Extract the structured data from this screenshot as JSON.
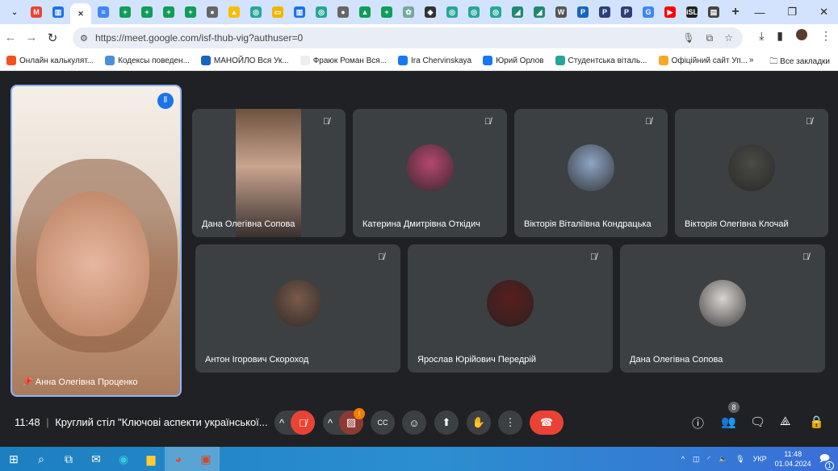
{
  "browser": {
    "tabs": [
      {
        "icon": "gmail-icon",
        "color": "#ea4335",
        "label": "M"
      },
      {
        "icon": "docs-icon",
        "color": "#1a73e8",
        "label": "▥"
      },
      {
        "icon": "close-icon",
        "color": "",
        "label": "✕",
        "active": true
      },
      {
        "icon": "docs-icon",
        "color": "#4285f4",
        "label": "≡"
      },
      {
        "icon": "sheets-icon",
        "color": "#0f9d58",
        "label": "+"
      },
      {
        "icon": "sheets-icon",
        "color": "#0f9d58",
        "label": "+"
      },
      {
        "icon": "sheets-icon",
        "color": "#0f9d58",
        "label": "+"
      },
      {
        "icon": "sheets-icon",
        "color": "#0f9d58",
        "label": "+"
      },
      {
        "icon": "globe-icon",
        "color": "#666",
        "label": "●"
      },
      {
        "icon": "drive-icon",
        "color": "#fbbc04",
        "label": "▲"
      },
      {
        "icon": "site-icon",
        "color": "#26a69a",
        "label": "◎"
      },
      {
        "icon": "slides-icon",
        "color": "#f4b400",
        "label": "▭"
      },
      {
        "icon": "docs-icon",
        "color": "#1a73e8",
        "label": "▥"
      },
      {
        "icon": "site-icon",
        "color": "#26a69a",
        "label": "◎"
      },
      {
        "icon": "globe-icon",
        "color": "#666",
        "label": "●"
      },
      {
        "icon": "drive-icon",
        "color": "#0f9d58",
        "label": "▲"
      },
      {
        "icon": "sheets-icon",
        "color": "#0f9d58",
        "label": "+"
      },
      {
        "icon": "chatgpt-icon",
        "color": "#74aa9c",
        "label": "✿"
      },
      {
        "icon": "site-icon",
        "color": "#333",
        "label": "◆"
      },
      {
        "icon": "site-icon",
        "color": "#26a69a",
        "label": "◎"
      },
      {
        "icon": "site-icon",
        "color": "#26a69a",
        "label": "◎"
      },
      {
        "icon": "site-icon",
        "color": "#26a69a",
        "label": "◎"
      },
      {
        "icon": "site-icon",
        "color": "#1f8a70",
        "label": "◢"
      },
      {
        "icon": "site-icon",
        "color": "#1f8a70",
        "label": "◢"
      },
      {
        "icon": "wikipedia-icon",
        "color": "#555",
        "label": "W"
      },
      {
        "icon": "site-icon",
        "color": "#1565c0",
        "label": "P"
      },
      {
        "icon": "site-icon",
        "color": "#2c3e7a",
        "label": "P"
      },
      {
        "icon": "site-icon",
        "color": "#2c3e7a",
        "label": "P"
      },
      {
        "icon": "translate-icon",
        "color": "#4285f4",
        "label": "G"
      },
      {
        "icon": "youtube-icon",
        "color": "#ff0000",
        "label": "▶"
      },
      {
        "icon": "site-icon",
        "color": "#222",
        "label": "iSL"
      },
      {
        "icon": "site-icon",
        "color": "#444",
        "label": "▤"
      }
    ],
    "new_tab": "+",
    "url": "https://meet.google.com/isf-thub-vig?authuser=0",
    "bookmarks": [
      {
        "label": "Онлайн калькулят...",
        "color": "#f4511e"
      },
      {
        "label": "Кодексы поведен...",
        "color": "#4a90d9"
      },
      {
        "label": "МАНОЙЛО Вся Ук...",
        "color": "#1565c0"
      },
      {
        "label": "Фраюк Роман Вся...",
        "color": "#eee"
      },
      {
        "label": "Ira Chervinskaya",
        "color": "#1877f2"
      },
      {
        "label": "Юрий Орлов",
        "color": "#1877f2"
      },
      {
        "label": "Студентська віталь...",
        "color": "#26a69a"
      },
      {
        "label": "Офіційний сайт Уп...",
        "color": "#f9a825"
      }
    ],
    "more_bookmarks": "»",
    "all_bookmarks": "Все закладки"
  },
  "meet": {
    "self": {
      "name": "Анна Олегівна Проценко"
    },
    "participants": [
      {
        "name": "Дана Олегівна Сопова",
        "video": true
      },
      {
        "name": "Катерина Дмитрівна Откідич",
        "color": "#b5476f"
      },
      {
        "name": "Вікторія Віталіївна Кондрацька",
        "color": "#8ea5c4"
      },
      {
        "name": "Вікторія Олегівна Клочай",
        "color": "#4b4b45"
      },
      {
        "name": "Антон Ігорович Скороход",
        "color": "#7a5a4a"
      },
      {
        "name": "Ярослав Юрійович Передрій",
        "color": "#5a1e1e"
      },
      {
        "name": "Дана Олегівна Сопова",
        "color": "#d9d4d0"
      }
    ],
    "time": "11:48",
    "meeting_title": "Круглий стіл \"Ключові аспекти української...",
    "participant_count": "8",
    "camera_alert": "!"
  },
  "taskbar": {
    "lang": "УКР",
    "time": "11:48",
    "date": "01.04.2024",
    "notifications": "1"
  }
}
